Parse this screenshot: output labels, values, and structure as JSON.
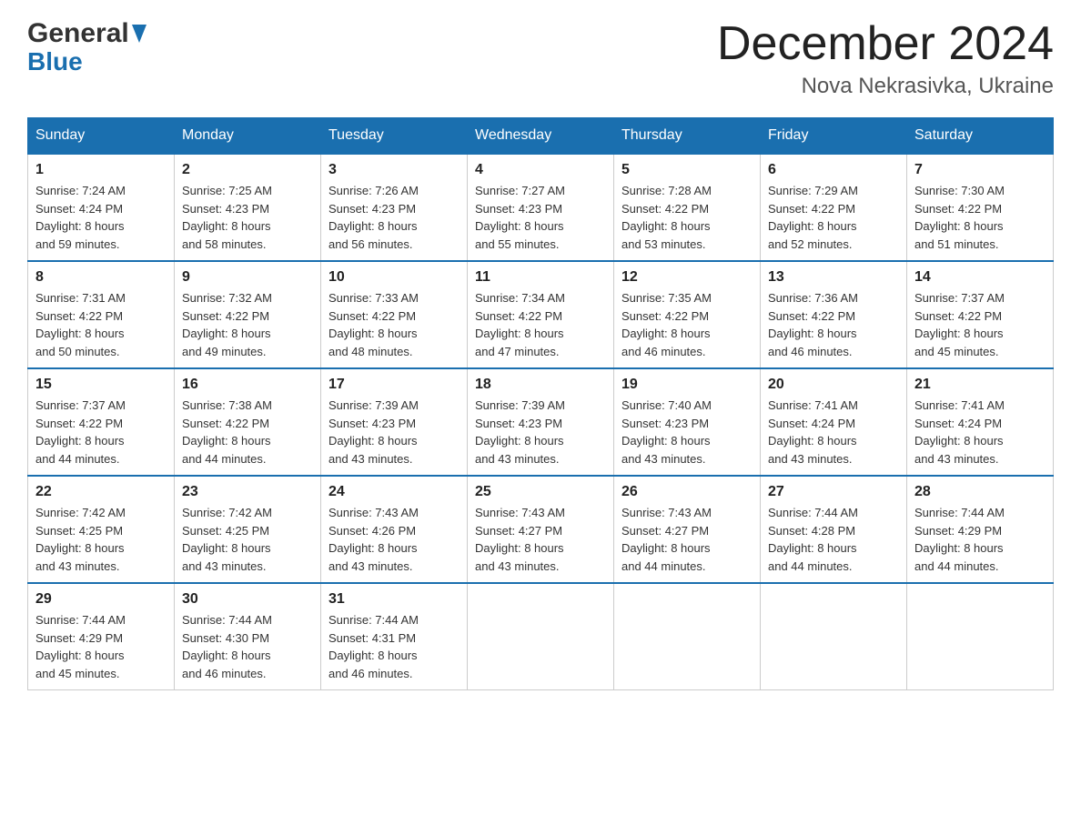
{
  "header": {
    "logo_general": "General",
    "logo_blue": "Blue",
    "month_title": "December 2024",
    "location": "Nova Nekrasivka, Ukraine"
  },
  "days_of_week": [
    "Sunday",
    "Monday",
    "Tuesday",
    "Wednesday",
    "Thursday",
    "Friday",
    "Saturday"
  ],
  "weeks": [
    [
      {
        "day": "1",
        "sunrise": "7:24 AM",
        "sunset": "4:24 PM",
        "daylight": "8 hours and 59 minutes."
      },
      {
        "day": "2",
        "sunrise": "7:25 AM",
        "sunset": "4:23 PM",
        "daylight": "8 hours and 58 minutes."
      },
      {
        "day": "3",
        "sunrise": "7:26 AM",
        "sunset": "4:23 PM",
        "daylight": "8 hours and 56 minutes."
      },
      {
        "day": "4",
        "sunrise": "7:27 AM",
        "sunset": "4:23 PM",
        "daylight": "8 hours and 55 minutes."
      },
      {
        "day": "5",
        "sunrise": "7:28 AM",
        "sunset": "4:22 PM",
        "daylight": "8 hours and 53 minutes."
      },
      {
        "day": "6",
        "sunrise": "7:29 AM",
        "sunset": "4:22 PM",
        "daylight": "8 hours and 52 minutes."
      },
      {
        "day": "7",
        "sunrise": "7:30 AM",
        "sunset": "4:22 PM",
        "daylight": "8 hours and 51 minutes."
      }
    ],
    [
      {
        "day": "8",
        "sunrise": "7:31 AM",
        "sunset": "4:22 PM",
        "daylight": "8 hours and 50 minutes."
      },
      {
        "day": "9",
        "sunrise": "7:32 AM",
        "sunset": "4:22 PM",
        "daylight": "8 hours and 49 minutes."
      },
      {
        "day": "10",
        "sunrise": "7:33 AM",
        "sunset": "4:22 PM",
        "daylight": "8 hours and 48 minutes."
      },
      {
        "day": "11",
        "sunrise": "7:34 AM",
        "sunset": "4:22 PM",
        "daylight": "8 hours and 47 minutes."
      },
      {
        "day": "12",
        "sunrise": "7:35 AM",
        "sunset": "4:22 PM",
        "daylight": "8 hours and 46 minutes."
      },
      {
        "day": "13",
        "sunrise": "7:36 AM",
        "sunset": "4:22 PM",
        "daylight": "8 hours and 46 minutes."
      },
      {
        "day": "14",
        "sunrise": "7:37 AM",
        "sunset": "4:22 PM",
        "daylight": "8 hours and 45 minutes."
      }
    ],
    [
      {
        "day": "15",
        "sunrise": "7:37 AM",
        "sunset": "4:22 PM",
        "daylight": "8 hours and 44 minutes."
      },
      {
        "day": "16",
        "sunrise": "7:38 AM",
        "sunset": "4:22 PM",
        "daylight": "8 hours and 44 minutes."
      },
      {
        "day": "17",
        "sunrise": "7:39 AM",
        "sunset": "4:23 PM",
        "daylight": "8 hours and 43 minutes."
      },
      {
        "day": "18",
        "sunrise": "7:39 AM",
        "sunset": "4:23 PM",
        "daylight": "8 hours and 43 minutes."
      },
      {
        "day": "19",
        "sunrise": "7:40 AM",
        "sunset": "4:23 PM",
        "daylight": "8 hours and 43 minutes."
      },
      {
        "day": "20",
        "sunrise": "7:41 AM",
        "sunset": "4:24 PM",
        "daylight": "8 hours and 43 minutes."
      },
      {
        "day": "21",
        "sunrise": "7:41 AM",
        "sunset": "4:24 PM",
        "daylight": "8 hours and 43 minutes."
      }
    ],
    [
      {
        "day": "22",
        "sunrise": "7:42 AM",
        "sunset": "4:25 PM",
        "daylight": "8 hours and 43 minutes."
      },
      {
        "day": "23",
        "sunrise": "7:42 AM",
        "sunset": "4:25 PM",
        "daylight": "8 hours and 43 minutes."
      },
      {
        "day": "24",
        "sunrise": "7:43 AM",
        "sunset": "4:26 PM",
        "daylight": "8 hours and 43 minutes."
      },
      {
        "day": "25",
        "sunrise": "7:43 AM",
        "sunset": "4:27 PM",
        "daylight": "8 hours and 43 minutes."
      },
      {
        "day": "26",
        "sunrise": "7:43 AM",
        "sunset": "4:27 PM",
        "daylight": "8 hours and 44 minutes."
      },
      {
        "day": "27",
        "sunrise": "7:44 AM",
        "sunset": "4:28 PM",
        "daylight": "8 hours and 44 minutes."
      },
      {
        "day": "28",
        "sunrise": "7:44 AM",
        "sunset": "4:29 PM",
        "daylight": "8 hours and 44 minutes."
      }
    ],
    [
      {
        "day": "29",
        "sunrise": "7:44 AM",
        "sunset": "4:29 PM",
        "daylight": "8 hours and 45 minutes."
      },
      {
        "day": "30",
        "sunrise": "7:44 AM",
        "sunset": "4:30 PM",
        "daylight": "8 hours and 46 minutes."
      },
      {
        "day": "31",
        "sunrise": "7:44 AM",
        "sunset": "4:31 PM",
        "daylight": "8 hours and 46 minutes."
      },
      null,
      null,
      null,
      null
    ]
  ],
  "labels": {
    "sunrise": "Sunrise:",
    "sunset": "Sunset:",
    "daylight": "Daylight:"
  }
}
